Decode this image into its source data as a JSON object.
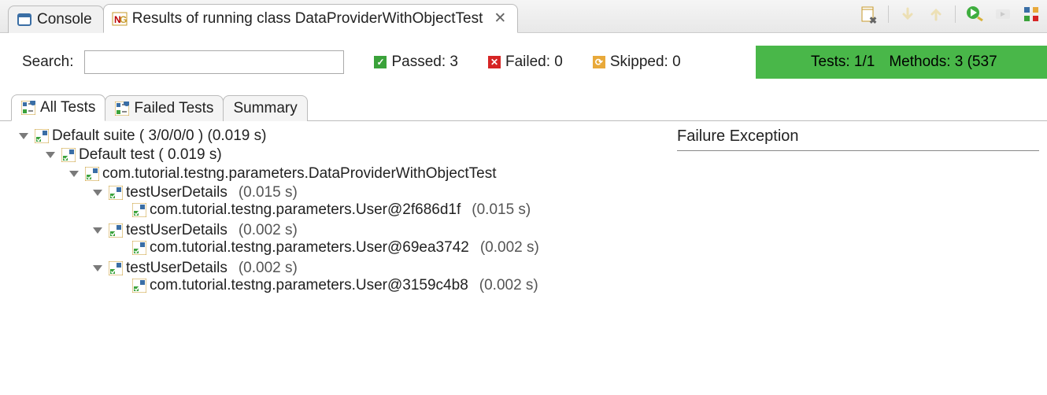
{
  "tabs": {
    "console_label": "Console",
    "results_label": "Results of running class DataProviderWithObjectTest"
  },
  "search": {
    "label": "Search:",
    "value": ""
  },
  "stats": {
    "passed_label": "Passed: 3",
    "failed_label": "Failed: 0",
    "skipped_label": "Skipped: 0"
  },
  "summary": {
    "tests": "Tests: 1/1",
    "methods": "Methods: 3 (537"
  },
  "result_tabs": {
    "all": "All Tests",
    "failed": "Failed Tests",
    "summary": "Summary"
  },
  "failure_header": "Failure Exception",
  "tree": {
    "suite_label": "Default suite ( 3/0/0/0 ) (0.019 s)",
    "test_label": "Default test ( 0.019 s)",
    "class_label": "com.tutorial.testng.parameters.DataProviderWithObjectTest",
    "method1": {
      "label": "testUserDetails",
      "time": "(0.015 s)",
      "invocation": "com.tutorial.testng.parameters.User@2f686d1f",
      "inv_time": "(0.015 s)"
    },
    "method2": {
      "label": "testUserDetails",
      "time": "(0.002 s)",
      "invocation": "com.tutorial.testng.parameters.User@69ea3742",
      "inv_time": "(0.002 s)"
    },
    "method3": {
      "label": "testUserDetails",
      "time": "(0.002 s)",
      "invocation": "com.tutorial.testng.parameters.User@3159c4b8",
      "inv_time": "(0.002 s)"
    }
  }
}
